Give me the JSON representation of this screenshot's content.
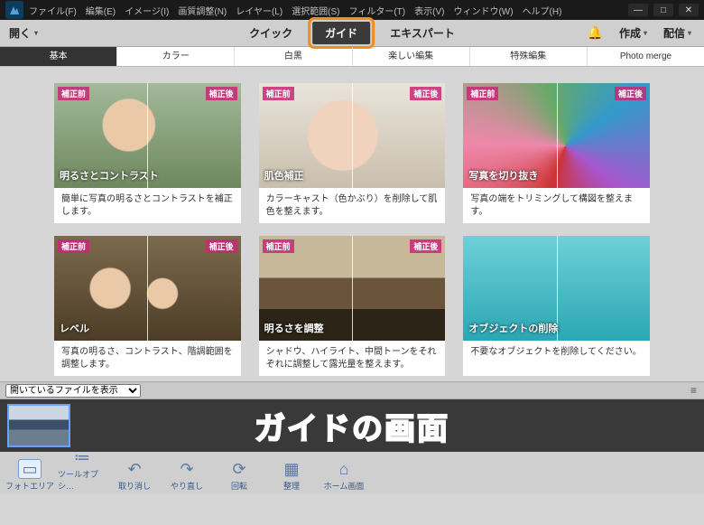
{
  "menubar": {
    "items": [
      "ファイル(F)",
      "編集(E)",
      "イメージ(I)",
      "画質調整(N)",
      "レイヤー(L)",
      "選択範囲(S)",
      "フィルター(T)",
      "表示(V)",
      "ウィンドウ(W)",
      "ヘルプ(H)"
    ]
  },
  "toolbar": {
    "open": "開く",
    "modes": {
      "quick": "クイック",
      "guide": "ガイド",
      "expert": "エキスパート"
    },
    "create": "作成",
    "share": "配信"
  },
  "category_tabs": [
    "基本",
    "カラー",
    "白黒",
    "楽しい編集",
    "特殊編集",
    "Photo merge"
  ],
  "cards": [
    {
      "before": "補正前",
      "after": "補正後",
      "title": "明るさとコントラスト",
      "desc": "簡単に写真の明るさとコントラストを補正します。"
    },
    {
      "before": "補正前",
      "after": "補正後",
      "title": "肌色補正",
      "desc": "カラーキャスト（色かぶり）を削除して肌色を整えます。"
    },
    {
      "before": "補正前",
      "after": "補正後",
      "title": "写真を切り抜き",
      "desc": "写真の端をトリミングして構図を整えます。"
    },
    {
      "before": "補正前",
      "after": "補正後",
      "title": "レベル",
      "desc": "写真の明るさ、コントラスト、階調範囲を調整します。"
    },
    {
      "before": "補正前",
      "after": "補正後",
      "title": "明るさを調整",
      "desc": "シャドウ、ハイライト、中間トーンをそれぞれに調整して露光量を整えます。"
    },
    {
      "before": "",
      "after": "",
      "title": "オブジェクトの削除",
      "desc": "不要なオブジェクトを削除してください。"
    }
  ],
  "filebar": {
    "label": "開いているファイルを表示"
  },
  "overlay_text": "ガイドの画面",
  "bottom": {
    "buttons": [
      {
        "label": "フォトエリア",
        "icon": "▭"
      },
      {
        "label": "ツールオプシ…",
        "icon": "≔"
      },
      {
        "label": "取り消し",
        "icon": "↶"
      },
      {
        "label": "やり直し",
        "icon": "↷"
      },
      {
        "label": "回転",
        "icon": "⟳"
      },
      {
        "label": "整理",
        "icon": "▦"
      },
      {
        "label": "ホーム画面",
        "icon": "⌂"
      }
    ]
  }
}
